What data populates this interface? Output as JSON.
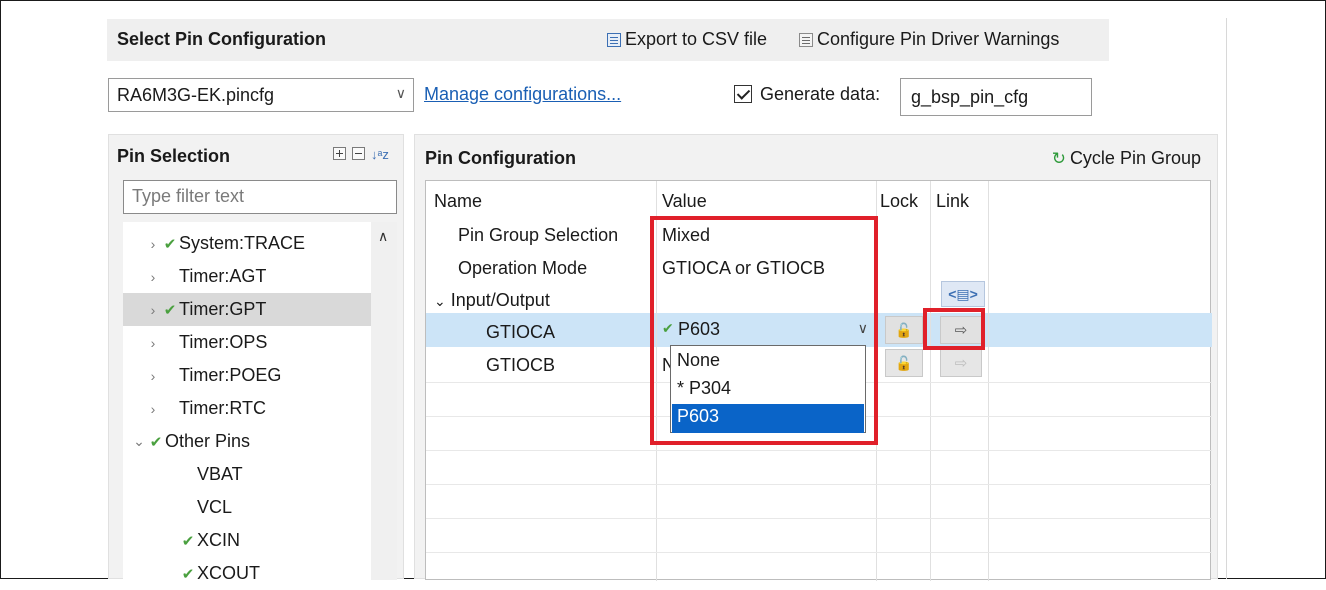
{
  "select_config": {
    "title": "Select Pin Configuration",
    "export_csv": "Export to CSV file",
    "configure_warnings": "Configure Pin Driver Warnings",
    "combo_value": "RA6M3G-EK.pincfg",
    "manage_link": "Manage configurations...",
    "generate_label": "Generate data:",
    "generate_checked": true,
    "generate_value": "g_bsp_pin_cfg"
  },
  "pin_selection": {
    "title": "Pin Selection",
    "filter_placeholder": "Type filter text",
    "items": [
      {
        "label": "System:TRACE",
        "twisty": "›",
        "checked": true
      },
      {
        "label": "Timer:AGT",
        "twisty": "›",
        "checked": false
      },
      {
        "label": "Timer:GPT",
        "twisty": "›",
        "checked": true,
        "selected": true
      },
      {
        "label": "Timer:OPS",
        "twisty": "›",
        "checked": false
      },
      {
        "label": "Timer:POEG",
        "twisty": "›",
        "checked": false
      },
      {
        "label": "Timer:RTC",
        "twisty": "›",
        "checked": false
      },
      {
        "label": "Other Pins",
        "twisty": "⌄",
        "checked": true
      },
      {
        "label": "VBAT",
        "twisty": "",
        "checked": false
      },
      {
        "label": "VCL",
        "twisty": "",
        "checked": false
      },
      {
        "label": "XCIN",
        "twisty": "",
        "checked": true
      },
      {
        "label": "XCOUT",
        "twisty": "",
        "checked": true
      }
    ]
  },
  "pin_configuration": {
    "title": "Pin Configuration",
    "cycle_label": "Cycle Pin Group",
    "columns": {
      "name": "Name",
      "value": "Value",
      "lock": "Lock",
      "link": "Link"
    },
    "rows": [
      {
        "name": "Pin Group Selection",
        "value": "Mixed"
      },
      {
        "name": "Operation Mode",
        "value": "GTIOCA or GTIOCB"
      },
      {
        "name": "Input/Output",
        "value": ""
      },
      {
        "name": "GTIOCA",
        "value": "P603"
      },
      {
        "name": "GTIOCB",
        "value": "N"
      }
    ],
    "dropdown_options": [
      "None",
      "* P304",
      "P603"
    ],
    "dropdown_selected": "P603"
  },
  "icons": {
    "check_color": "#4aa03f",
    "highlight_color": "#e0202a",
    "selection_color": "#0a64c8"
  }
}
